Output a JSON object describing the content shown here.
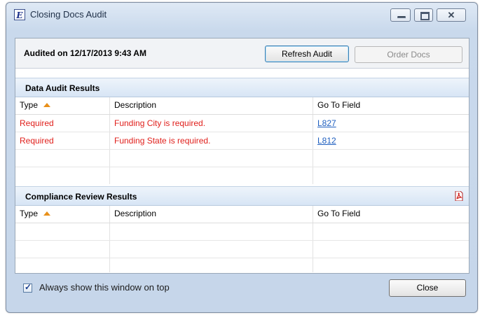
{
  "window": {
    "title": "Closing Docs Audit",
    "icon_letter": "E",
    "controls": {
      "minimize": "minimize-icon",
      "maximize": "maximize-icon",
      "close": "close-icon",
      "close_glyph": "✕"
    }
  },
  "header": {
    "audited_text": "Audited on 12/17/2013 9:43 AM",
    "refresh_label": "Refresh Audit",
    "order_label": "Order Docs"
  },
  "data_audit": {
    "title": "Data Audit Results",
    "columns": [
      "Type",
      "Description",
      "Go To Field"
    ],
    "rows": [
      {
        "type": "Required",
        "description": "Funding City is required.",
        "field": "L827"
      },
      {
        "type": "Required",
        "description": "Funding State is required.",
        "field": "L812"
      }
    ]
  },
  "compliance": {
    "title": "Compliance Review Results",
    "columns": [
      "Type",
      "Description",
      "Go To Field"
    ],
    "rows": []
  },
  "footer": {
    "checkbox_label": "Always show this window on top",
    "checkbox_checked": true,
    "close_label": "Close"
  },
  "colors": {
    "error": "#e0201c",
    "link": "#1f5fbf",
    "sort_arrow": "#e8901a"
  }
}
